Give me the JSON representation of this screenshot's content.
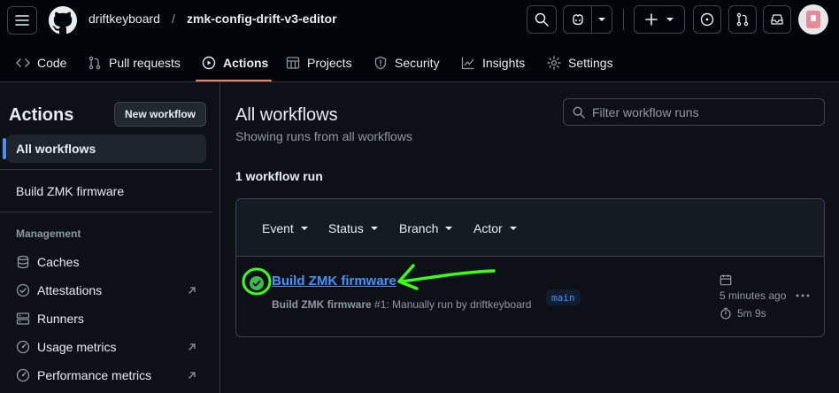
{
  "header": {
    "owner": "driftkeyboard",
    "separator": "/",
    "repo": "zmk-config-drift-v3-editor"
  },
  "repo_nav": {
    "code": "Code",
    "pulls": "Pull requests",
    "actions": "Actions",
    "projects": "Projects",
    "security": "Security",
    "insights": "Insights",
    "settings": "Settings"
  },
  "sidebar": {
    "title": "Actions",
    "new_workflow": "New workflow",
    "all_workflows": "All workflows",
    "workflow_item": "Build ZMK firmware",
    "management_heading": "Management",
    "items": {
      "caches": "Caches",
      "attestations": "Attestations",
      "runners": "Runners",
      "usage_metrics": "Usage metrics",
      "performance_metrics": "Performance metrics"
    }
  },
  "main": {
    "title": "All workflows",
    "subtitle": "Showing runs from all workflows",
    "filter_placeholder": "Filter workflow runs",
    "run_count": "1 workflow run",
    "filters": {
      "event": "Event",
      "status": "Status",
      "branch": "Branch",
      "actor": "Actor"
    },
    "run": {
      "title": "Build ZMK firmware",
      "meta_workflow": "Build ZMK firmware",
      "meta_rest": " #1: Manually run by driftkeyboard",
      "branch": "main",
      "time_ago": "5 minutes ago",
      "duration": "5m 9s",
      "status": "success"
    }
  },
  "colors": {
    "accent": "#4493f8",
    "success": "#3fb950",
    "annotation": "#39ff14",
    "active_tab": "#f78166"
  }
}
